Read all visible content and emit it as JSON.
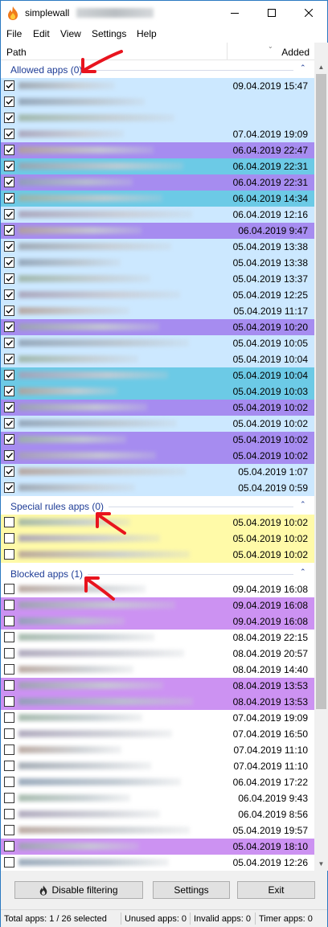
{
  "window": {
    "title": "simplewall",
    "controls": [
      "minimize",
      "maximize",
      "close"
    ]
  },
  "menu": [
    "File",
    "Edit",
    "View",
    "Settings",
    "Help"
  ],
  "columns": {
    "path": "Path",
    "added": "Added"
  },
  "groups": [
    {
      "label": "Allowed apps (0)",
      "rows": [
        {
          "checked": true,
          "date": "09.04.2019 15:47",
          "bg": "#cce8ff"
        },
        {
          "checked": true,
          "date": "",
          "bg": "#cce8ff"
        },
        {
          "checked": true,
          "date": "",
          "bg": "#cce8ff"
        },
        {
          "checked": true,
          "date": "07.04.2019 19:09",
          "bg": "#cce8ff"
        },
        {
          "checked": true,
          "date": "06.04.2019 22:47",
          "bg": "#a68cf0"
        },
        {
          "checked": true,
          "date": "06.04.2019 22:31",
          "bg": "#6ccae6"
        },
        {
          "checked": true,
          "date": "06.04.2019 22:31",
          "bg": "#a68cf0"
        },
        {
          "checked": true,
          "date": "06.04.2019 14:34",
          "bg": "#6ccae6"
        },
        {
          "checked": true,
          "date": "06.04.2019 12:16",
          "bg": "#cce8ff"
        },
        {
          "checked": true,
          "date": "06.04.2019 9:47",
          "bg": "#a68cf0"
        },
        {
          "checked": true,
          "date": "05.04.2019 13:38",
          "bg": "#cce8ff"
        },
        {
          "checked": true,
          "date": "05.04.2019 13:38",
          "bg": "#cce8ff"
        },
        {
          "checked": true,
          "date": "05.04.2019 13:37",
          "bg": "#cce8ff"
        },
        {
          "checked": true,
          "date": "05.04.2019 12:25",
          "bg": "#cce8ff"
        },
        {
          "checked": true,
          "date": "05.04.2019 11:17",
          "bg": "#cce8ff"
        },
        {
          "checked": true,
          "date": "05.04.2019 10:20",
          "bg": "#a68cf0"
        },
        {
          "checked": true,
          "date": "05.04.2019 10:05",
          "bg": "#cce8ff"
        },
        {
          "checked": true,
          "date": "05.04.2019 10:04",
          "bg": "#cce8ff"
        },
        {
          "checked": true,
          "date": "05.04.2019 10:04",
          "bg": "#6ccae6"
        },
        {
          "checked": true,
          "date": "05.04.2019 10:03",
          "bg": "#6ccae6"
        },
        {
          "checked": true,
          "date": "05.04.2019 10:02",
          "bg": "#a68cf0"
        },
        {
          "checked": true,
          "date": "05.04.2019 10:02",
          "bg": "#cce8ff"
        },
        {
          "checked": true,
          "date": "05.04.2019 10:02",
          "bg": "#a68cf0"
        },
        {
          "checked": true,
          "date": "05.04.2019 10:02",
          "bg": "#a68cf0"
        },
        {
          "checked": true,
          "date": "05.04.2019 1:07",
          "bg": "#cce8ff"
        },
        {
          "checked": true,
          "date": "05.04.2019 0:59",
          "bg": "#cce8ff"
        }
      ]
    },
    {
      "label": "Special rules apps (0)",
      "rows": [
        {
          "checked": false,
          "date": "05.04.2019 10:02",
          "bg": "#fffaa8"
        },
        {
          "checked": false,
          "date": "05.04.2019 10:02",
          "bg": "#fffaa8"
        },
        {
          "checked": false,
          "date": "05.04.2019 10:02",
          "bg": "#fffaa8"
        }
      ]
    },
    {
      "label": "Blocked apps (1)",
      "rows": [
        {
          "checked": false,
          "date": "09.04.2019 16:08",
          "bg": "#ffffff"
        },
        {
          "checked": false,
          "date": "09.04.2019 16:08",
          "bg": "#cc92f2"
        },
        {
          "checked": false,
          "date": "09.04.2019 16:08",
          "bg": "#cc92f2"
        },
        {
          "checked": false,
          "date": "08.04.2019 22:15",
          "bg": "#ffffff"
        },
        {
          "checked": false,
          "date": "08.04.2019 20:57",
          "bg": "#ffffff"
        },
        {
          "checked": false,
          "date": "08.04.2019 14:40",
          "bg": "#ffffff"
        },
        {
          "checked": false,
          "date": "08.04.2019 13:53",
          "bg": "#cc92f2"
        },
        {
          "checked": false,
          "date": "08.04.2019 13:53",
          "bg": "#cc92f2"
        },
        {
          "checked": false,
          "date": "07.04.2019 19:09",
          "bg": "#ffffff"
        },
        {
          "checked": false,
          "date": "07.04.2019 16:50",
          "bg": "#ffffff"
        },
        {
          "checked": false,
          "date": "07.04.2019 11:10",
          "bg": "#ffffff"
        },
        {
          "checked": false,
          "date": "07.04.2019 11:10",
          "bg": "#ffffff"
        },
        {
          "checked": false,
          "date": "06.04.2019 17:22",
          "bg": "#ffffff"
        },
        {
          "checked": false,
          "date": "06.04.2019 9:43",
          "bg": "#ffffff"
        },
        {
          "checked": false,
          "date": "06.04.2019 8:56",
          "bg": "#ffffff"
        },
        {
          "checked": false,
          "date": "05.04.2019 19:57",
          "bg": "#ffffff"
        },
        {
          "checked": false,
          "date": "05.04.2019 18:10",
          "bg": "#cc92f2"
        },
        {
          "checked": false,
          "date": "05.04.2019 12:26",
          "bg": "#ffffff"
        }
      ]
    }
  ],
  "buttons": {
    "disable_filtering": "Disable filtering",
    "settings": "Settings",
    "exit": "Exit"
  },
  "status": {
    "total": "Total apps: 1 / 26 selected",
    "unused": "Unused apps: 0",
    "invalid": "Invalid apps: 0",
    "timer": "Timer apps: 0"
  },
  "colors": {
    "allowed_row": "#cce8ff",
    "purple_row": "#a68cf0",
    "cyan_row": "#6ccae6",
    "special_row": "#fffaa8",
    "blocked_purple_row": "#cc92f2",
    "group_text": "#1e3c96",
    "annotation_arrow": "#e8141e"
  }
}
